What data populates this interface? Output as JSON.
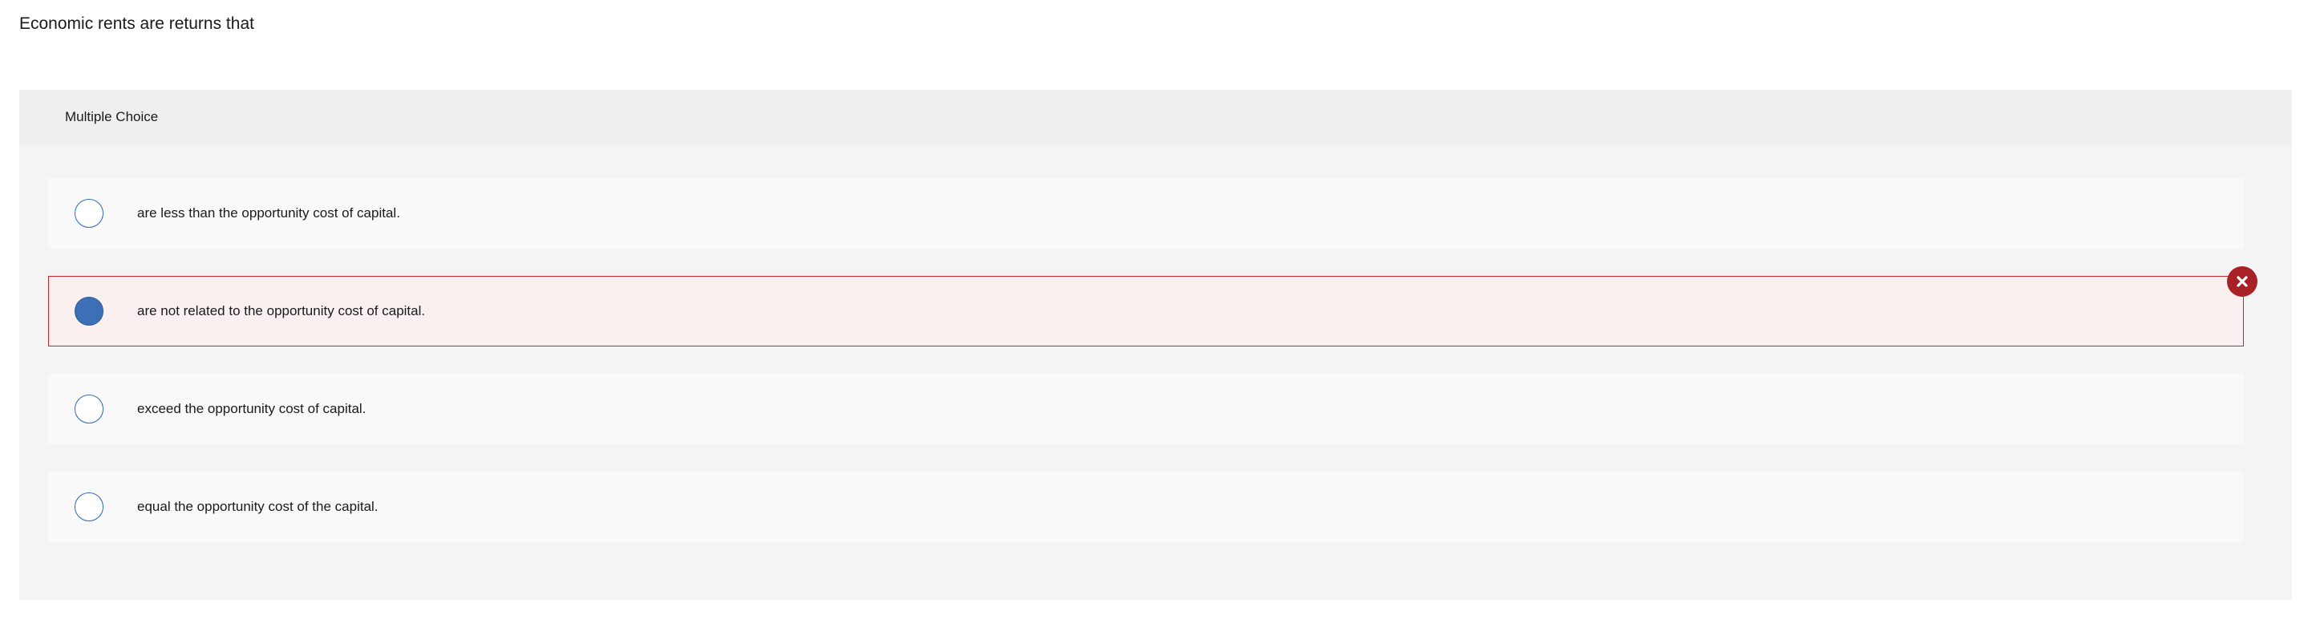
{
  "question": {
    "prompt": "Economic rents are returns that"
  },
  "panel": {
    "header_label": "Multiple Choice"
  },
  "options": [
    {
      "text": "are less than the opportunity cost of capital.",
      "selected": false,
      "state": "neutral"
    },
    {
      "text": "are not related to the opportunity cost of capital.",
      "selected": true,
      "state": "incorrect"
    },
    {
      "text": "exceed the opportunity cost of capital.",
      "selected": false,
      "state": "neutral"
    },
    {
      "text": "equal the opportunity cost of the capital.",
      "selected": false,
      "state": "neutral"
    }
  ],
  "icons": {
    "wrong_badge": "close-x-icon"
  },
  "colors": {
    "radio_border": "#2f67b1",
    "radio_selected": "#3c6fb5",
    "incorrect_border": "#c8252c",
    "incorrect_background": "#fbf0f0",
    "wrong_badge": "#a72126"
  }
}
